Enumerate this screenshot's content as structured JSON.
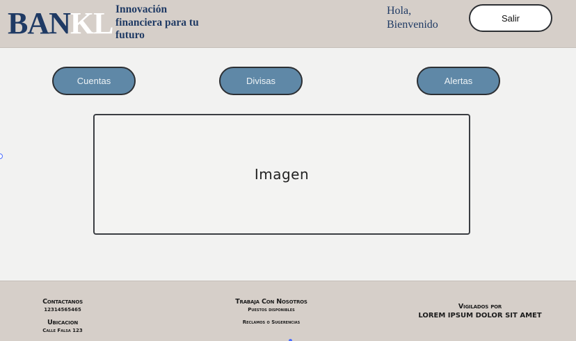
{
  "header": {
    "logo_primary": "BAN",
    "logo_secondary": "KL",
    "tagline": "Innovación financiera para tu futuro",
    "greeting": "Hola, Bienvenido",
    "logout_label": "Salir"
  },
  "nav": {
    "accounts_label": "Cuentas",
    "currencies_label": "Divisas",
    "alerts_label": "Alertas"
  },
  "main": {
    "image_placeholder": "Imagen"
  },
  "footer": {
    "contact_heading": "Contactanos",
    "contact_phone": "12314565465",
    "location_heading": "Ubicacion",
    "location_address": "Calle Falsa 123",
    "work_heading": "Trabaja Con Nosotros",
    "work_sub": "Puestos disponibles",
    "claims": "Reclamos o Sugerencias",
    "supervised_line1": "Vigilados por",
    "supervised_line2": "LOREM IPSUM DOLOR SIT AMET"
  },
  "colors": {
    "header_bg": "#d6cfc9",
    "brand_navy": "#1f3a64",
    "nav_button": "#5f88a7",
    "page_bg": "#f2f2f1"
  }
}
